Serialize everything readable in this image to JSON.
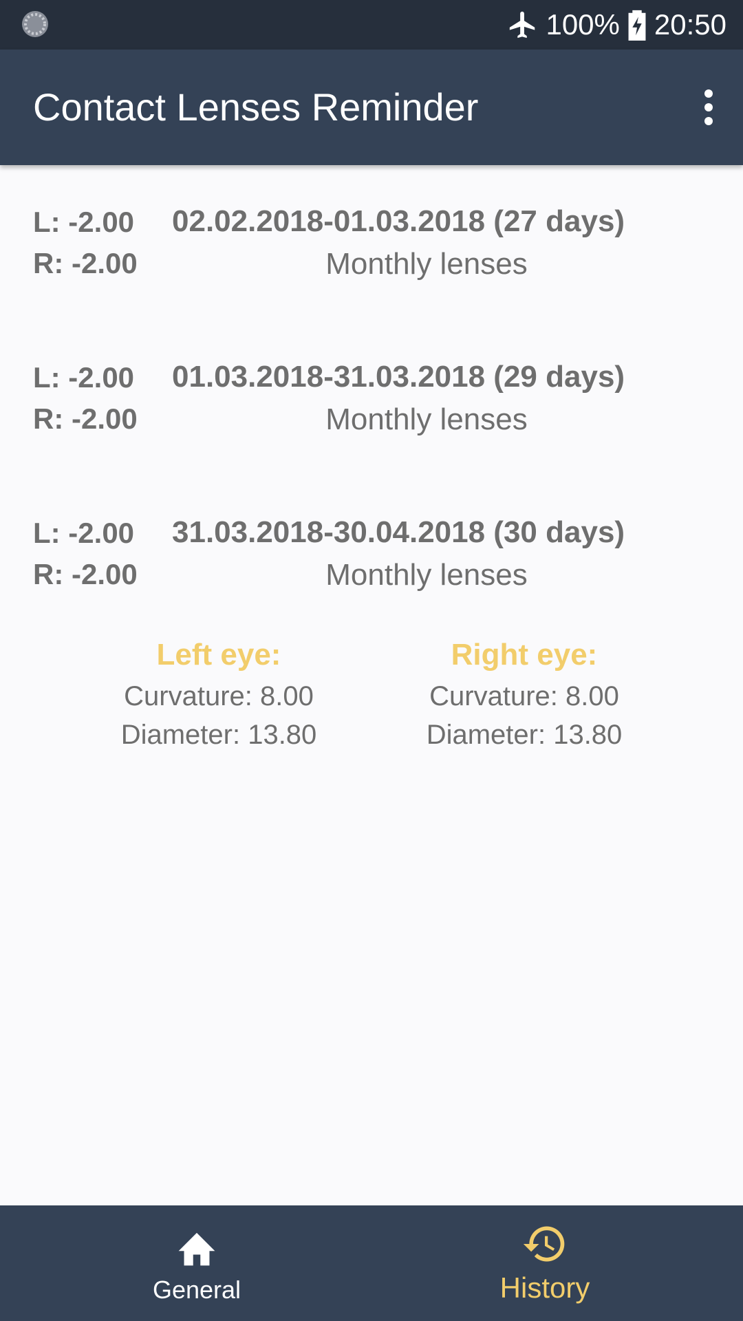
{
  "status_bar": {
    "battery": "100%",
    "time": "20:50",
    "icons": [
      "loading-circle-icon",
      "airplane-icon",
      "battery-charging-icon"
    ]
  },
  "app_bar": {
    "title": "Contact Lenses Reminder",
    "menu_icon": "more-vert-icon"
  },
  "history": [
    {
      "left": "L: -2.00",
      "right": "R: -2.00",
      "dates": "02.02.2018-01.03.2018 (27 days)",
      "type": "Monthly lenses"
    },
    {
      "left": "L: -2.00",
      "right": "R: -2.00",
      "dates": "01.03.2018-31.03.2018 (29 days)",
      "type": "Monthly lenses"
    },
    {
      "left": "L: -2.00",
      "right": "R: -2.00",
      "dates": "31.03.2018-30.04.2018 (30 days)",
      "type": "Monthly lenses"
    }
  ],
  "eyes": {
    "left": {
      "title": "Left eye:",
      "curvature": "Curvature: 8.00",
      "diameter": "Diameter: 13.80"
    },
    "right": {
      "title": "Right eye:",
      "curvature": "Curvature: 8.00",
      "diameter": "Diameter: 13.80"
    }
  },
  "bottom_nav": {
    "items": [
      {
        "label": "General",
        "icon": "home-icon",
        "active": false
      },
      {
        "label": "History",
        "icon": "history-icon",
        "active": true
      }
    ]
  },
  "colors": {
    "status_bar": "#262f3c",
    "app_bar": "#344256",
    "accent": "#f2cd6b",
    "text": "#6e6e6e",
    "background": "#fafafc"
  }
}
